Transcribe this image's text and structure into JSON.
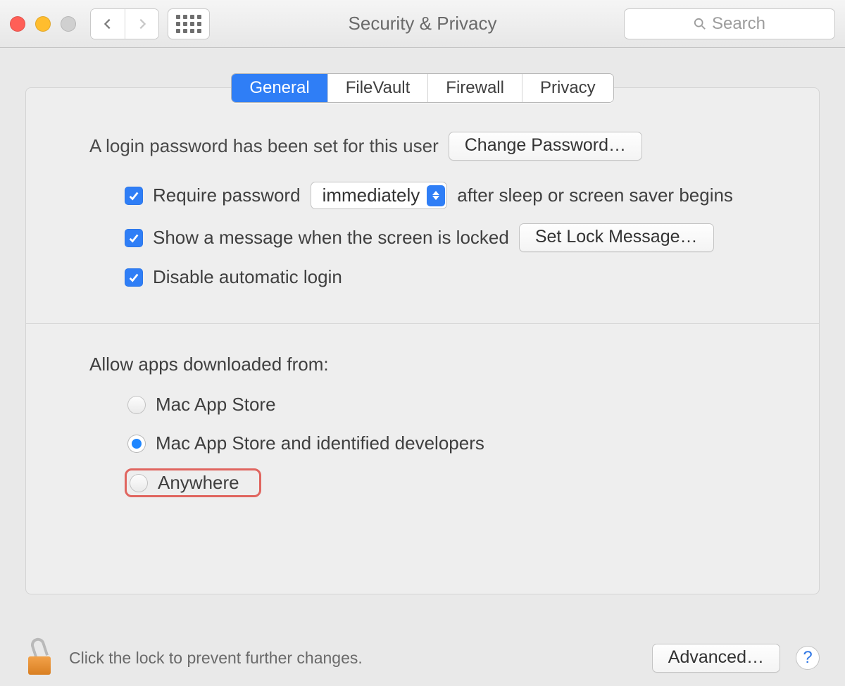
{
  "window": {
    "title": "Security & Privacy"
  },
  "toolbar": {
    "search_placeholder": "Search"
  },
  "tabs": {
    "general": "General",
    "filevault": "FileVault",
    "firewall": "Firewall",
    "privacy": "Privacy"
  },
  "general": {
    "login_password_set": "A login password has been set for this user",
    "change_password_btn": "Change Password…",
    "require_password_label": "Require password",
    "require_password_delay": "immediately",
    "require_password_after": "after sleep or screen saver begins",
    "show_message_label": "Show a message when the screen is locked",
    "set_lock_message_btn": "Set Lock Message…",
    "disable_auto_login": "Disable automatic login",
    "allow_apps_heading": "Allow apps downloaded from:",
    "radio_mac_app_store": "Mac App Store",
    "radio_identified": "Mac App Store and identified developers",
    "radio_anywhere": "Anywhere"
  },
  "footer": {
    "lock_text": "Click the lock to prevent further changes.",
    "advanced_btn": "Advanced…",
    "help": "?"
  }
}
